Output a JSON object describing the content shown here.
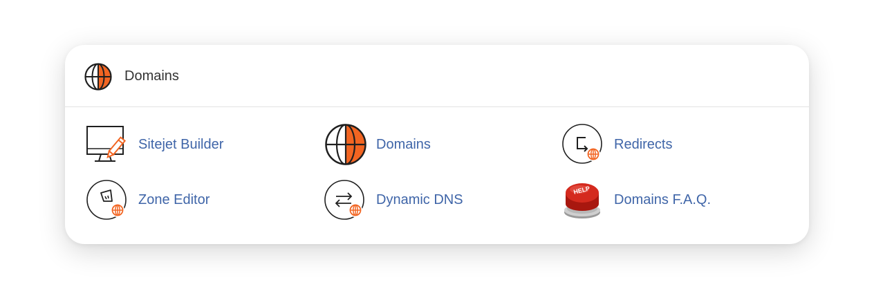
{
  "header": {
    "title": "Domains",
    "icon": "globe-icon"
  },
  "colors": {
    "accent": "#f26522",
    "link": "#3f65a8",
    "help_red": "#d42a1e"
  },
  "items": [
    {
      "label": "Sitejet Builder",
      "icon": "monitor-pencil-icon"
    },
    {
      "label": "Domains",
      "icon": "globe-icon"
    },
    {
      "label": "Redirects",
      "icon": "redirect-globe-icon"
    },
    {
      "label": "Zone Editor",
      "icon": "zone-editor-icon"
    },
    {
      "label": "Dynamic DNS",
      "icon": "dynamic-dns-icon"
    },
    {
      "label": "Domains F.A.Q.",
      "icon": "help-button-icon",
      "badge_text": "HELP"
    }
  ]
}
